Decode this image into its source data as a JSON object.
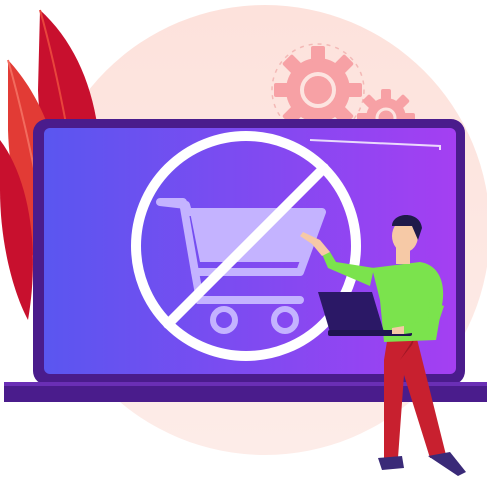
{
  "illustration": {
    "subject": "",
    "icon": "no-shopping-cart-icon"
  },
  "colors": {
    "background_circle": "#fde4e0",
    "leaf_dark": "#c8102e",
    "leaf_light": "#e8453c",
    "gear": "#f7a1a5",
    "monitor_frame": "#4a1c8c",
    "monitor_stand": "#6a2fb5",
    "screen_left": "#5a56f0",
    "screen_right": "#a43ff2",
    "prohibit_stroke": "#ffffff",
    "cart": "#c4b3ff",
    "shirt": "#7be34d",
    "pants": "#c8202f",
    "skin": "#f6c9a6",
    "hair": "#1f1a4a",
    "laptop": "#2b1866",
    "shoes": "#3a2a78"
  }
}
